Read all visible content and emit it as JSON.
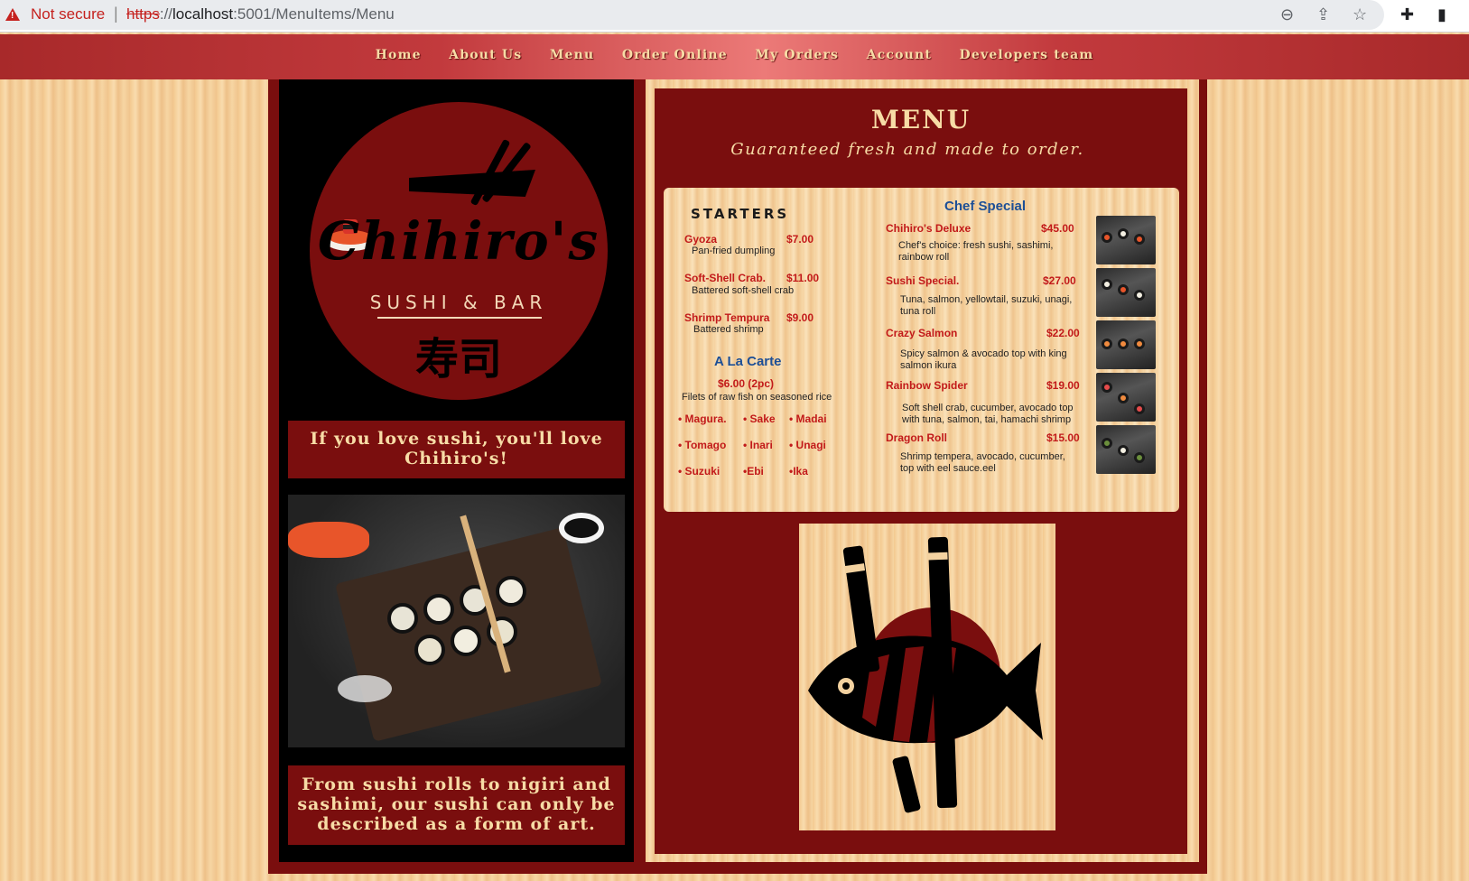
{
  "browser": {
    "security_label": "Not secure",
    "url_scheme": "https",
    "url_sep": "://",
    "url_host": "localhost",
    "url_path": ":5001/MenuItems/Menu"
  },
  "nav": {
    "items": [
      "Home",
      "About Us",
      "Menu",
      "Order Online",
      "My Orders",
      "Account",
      "Developers team"
    ]
  },
  "logo": {
    "name": "Chihiro's",
    "subtitle": "SUSHI & BAR",
    "kanji": "寿司"
  },
  "left": {
    "tagline": "If you love sushi, you'll love Chihiro's!",
    "description": "From sushi rolls to nigiri and sashimi, our sushi can only be described as a form of art."
  },
  "menu": {
    "title": "MENU",
    "subtitle": "Guaranteed fresh and made to order.",
    "starters": {
      "heading": "STARTERS",
      "items": [
        {
          "name": "Gyoza",
          "price": "$7.00",
          "desc": "Pan-fried dumpling"
        },
        {
          "name": "Soft-Shell Crab.",
          "price": "$11.00",
          "desc": "Battered soft-shell crab"
        },
        {
          "name": "Shrimp Tempura",
          "price": "$9.00",
          "desc": "Battered shrimp"
        }
      ]
    },
    "a_la_carte": {
      "heading": "A La Carte",
      "price": "$6.00  (2pc)",
      "desc": "Filets of raw fish on seasoned rice",
      "items": [
        "• Magura.",
        "• Sake",
        "• Madai",
        "• Tomago",
        "• Inari",
        "• Unagi",
        "• Suzuki",
        "•Ebi",
        "•Ika"
      ]
    },
    "chef_special": {
      "heading": "Chef Special",
      "items": [
        {
          "name": "Chihiro's Deluxe",
          "price": "$45.00",
          "desc": "Chef's choice: fresh sushi, sashimi, rainbow roll"
        },
        {
          "name": "Sushi Special.",
          "price": "$27.00",
          "desc": "Tuna, salmon, yellowtail, suzuki, unagi, tuna roll"
        },
        {
          "name": "Crazy Salmon",
          "price": "$22.00",
          "desc": "Spicy salmon & avocado top with king salmon ikura"
        },
        {
          "name": "Rainbow Spider",
          "price": "$19.00",
          "desc": "Soft shell crab, cucumber, avocado top with tuna, salmon, tai, hamachi shrimp"
        },
        {
          "name": "Dragon Roll",
          "price": "$15.00",
          "desc": "Shrimp tempera, avocado, cucumber, top with eel sauce.eel"
        }
      ]
    }
  },
  "colors": {
    "brand_red": "#7a0e0e",
    "cream": "#f7dca6",
    "price_red": "#c21a1a",
    "heading_blue": "#1d4f96"
  }
}
